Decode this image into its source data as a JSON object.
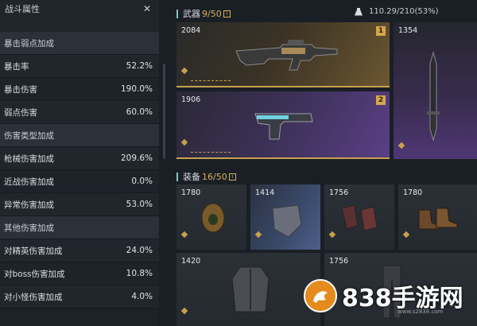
{
  "stats": {
    "title": "战斗属性",
    "rows": [
      {
        "type": "section",
        "label": "暴击弱点加成",
        "value": ""
      },
      {
        "type": "item",
        "label": "暴击率",
        "value": "52.2%"
      },
      {
        "type": "item",
        "label": "暴击伤害",
        "value": "190.0%"
      },
      {
        "type": "item",
        "label": "弱点伤害",
        "value": "60.0%"
      },
      {
        "type": "section",
        "label": "伤害类型加成",
        "value": ""
      },
      {
        "type": "item",
        "label": "枪械伤害加成",
        "value": "209.6%"
      },
      {
        "type": "item",
        "label": "近战伤害加成",
        "value": "0.0%"
      },
      {
        "type": "item",
        "label": "异常伤害加成",
        "value": "53.0%"
      },
      {
        "type": "section",
        "label": "其他伤害加成",
        "value": ""
      },
      {
        "type": "item",
        "label": "对精英伤害加成",
        "value": "24.0%"
      },
      {
        "type": "item",
        "label": "对boss伤害加成",
        "value": "10.8%"
      },
      {
        "type": "item",
        "label": "对小怪伤害加成",
        "value": "4.0%"
      }
    ]
  },
  "weapons": {
    "label": "武器",
    "count": "9/50",
    "info": "i",
    "cards": [
      {
        "value": "2084",
        "slot": "1",
        "icon": "rifle-icon"
      },
      {
        "value": "1354",
        "slot": "",
        "icon": "sword-icon"
      },
      {
        "value": "1906",
        "slot": "2",
        "icon": "pistol-icon"
      }
    ]
  },
  "weight": "110.29/210(53%)",
  "equipment": {
    "label": "装备",
    "count": "16/50",
    "info": "i",
    "cards": [
      {
        "value": "1780",
        "icon": "helmet-icon"
      },
      {
        "value": "1414",
        "icon": "mask-icon"
      },
      {
        "value": "1756",
        "icon": "gloves-icon"
      },
      {
        "value": "1780",
        "icon": "boots-icon"
      },
      {
        "value": "1420",
        "icon": "jacket-icon"
      },
      {
        "value": "1756",
        "icon": "pants-icon"
      }
    ]
  },
  "watermark": {
    "text": "838手游网",
    "sub": "www.s2838.com"
  },
  "colors": {
    "accent": "#6fd0c2",
    "gold": "#c9a04d",
    "purple": "#5a3f86"
  }
}
